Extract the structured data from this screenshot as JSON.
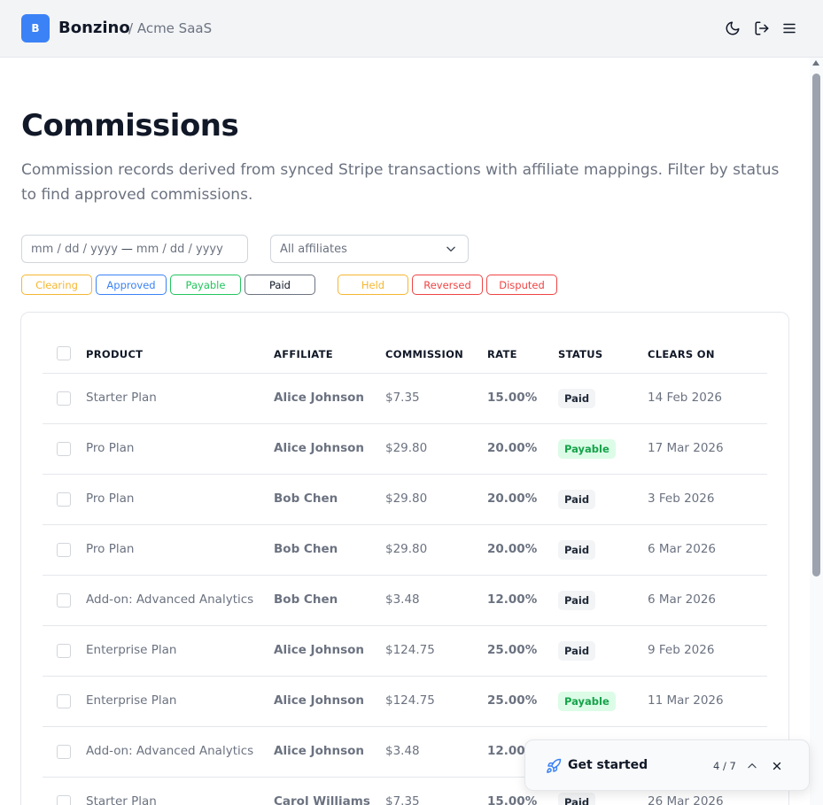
{
  "header": {
    "logo_letter": "B",
    "brand": "Bonzino",
    "breadcrumb": "/ Acme SaaS"
  },
  "page": {
    "title": "Commissions",
    "description": "Commission records derived from synced Stripe transactions with affiliate mappings. Filter by status to find approved commissions."
  },
  "filters": {
    "date_from": "mm /  dd  /  yyyy",
    "date_sep": "—",
    "date_to": "mm /  dd  /  yyyy",
    "affiliate_select": "All affiliates",
    "chips": [
      {
        "label": "Clearing",
        "color": "#f5b731"
      },
      {
        "label": "Approved",
        "color": "#3b82f6"
      },
      {
        "label": "Payable",
        "color": "#22c55e"
      },
      {
        "label": "Paid",
        "color": "#6b7280"
      },
      {
        "label": "Held",
        "color": "#f5b731"
      },
      {
        "label": "Reversed",
        "color": "#ef4444"
      },
      {
        "label": "Disputed",
        "color": "#ef4444"
      }
    ]
  },
  "table": {
    "columns": [
      "PRODUCT",
      "AFFILIATE",
      "COMMISSION",
      "RATE",
      "STATUS",
      "CLEARS ON"
    ],
    "rows": [
      {
        "product": "Starter Plan",
        "affiliate": "Alice Johnson",
        "commission": "$7.35",
        "rate": "15.00%",
        "status": "Paid",
        "clears_on": "14 Feb 2026"
      },
      {
        "product": "Pro Plan",
        "affiliate": "Alice Johnson",
        "commission": "$29.80",
        "rate": "20.00%",
        "status": "Payable",
        "clears_on": "17 Mar 2026"
      },
      {
        "product": "Pro Plan",
        "affiliate": "Bob Chen",
        "commission": "$29.80",
        "rate": "20.00%",
        "status": "Paid",
        "clears_on": "3 Feb 2026"
      },
      {
        "product": "Pro Plan",
        "affiliate": "Bob Chen",
        "commission": "$29.80",
        "rate": "20.00%",
        "status": "Paid",
        "clears_on": "6 Mar 2026"
      },
      {
        "product": "Add-on: Advanced Analytics",
        "affiliate": "Bob Chen",
        "commission": "$3.48",
        "rate": "12.00%",
        "status": "Paid",
        "clears_on": "6 Mar 2026"
      },
      {
        "product": "Enterprise Plan",
        "affiliate": "Alice Johnson",
        "commission": "$124.75",
        "rate": "25.00%",
        "status": "Paid",
        "clears_on": "9 Feb 2026"
      },
      {
        "product": "Enterprise Plan",
        "affiliate": "Alice Johnson",
        "commission": "$124.75",
        "rate": "25.00%",
        "status": "Payable",
        "clears_on": "11 Mar 2026"
      },
      {
        "product": "Add-on: Advanced Analytics",
        "affiliate": "Alice Johnson",
        "commission": "$3.48",
        "rate": "12.00%",
        "status": "",
        "clears_on": ""
      },
      {
        "product": "Starter Plan",
        "affiliate": "Carol Williams",
        "commission": "$7.35",
        "rate": "15.00%",
        "status": "Paid",
        "clears_on": "26 Mar 2026"
      }
    ]
  },
  "get_started": {
    "label": "Get started",
    "step": "4 / 7"
  }
}
